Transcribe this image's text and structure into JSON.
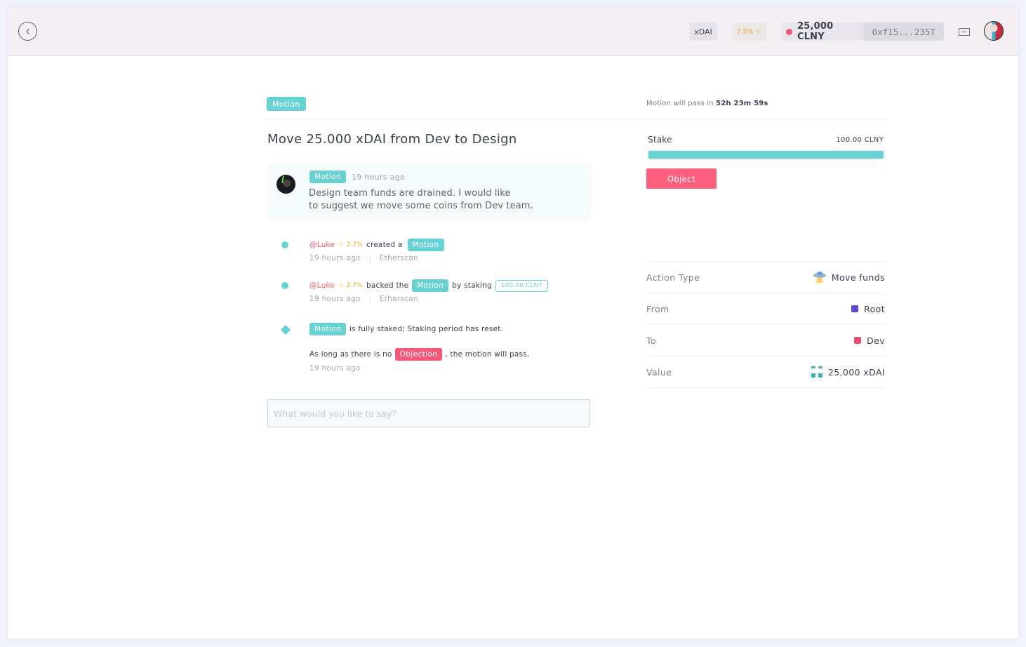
{
  "header": {
    "network": "xDAI",
    "reputation": "7.5%",
    "wallet_balance": "25,000 CLNY",
    "wallet_address": "0xf15...235T"
  },
  "motion": {
    "badge": "Motion",
    "timer_prefix": "Motion will pass in",
    "timer_value": "52h 23m 59s",
    "title": "Move 25.000 xDAI from Dev to Design"
  },
  "comment": {
    "badge": "Motion",
    "time": "19 hours ago",
    "text_line1": "Design team funds are drained. I would like",
    "text_line2": "to suggest we move some coins from Dev team."
  },
  "events": [
    {
      "user": "@Luke",
      "reputation": "2.7%",
      "action": "created a",
      "badge": "Motion",
      "time": "19 hours ago",
      "link": "Etherscan"
    },
    {
      "user": "@Luke",
      "reputation": "2.7%",
      "action": "backed the",
      "badge": "Motion",
      "action2": "by staking",
      "amount": "100.00 CLNY",
      "time": "19 hours ago",
      "link": "Etherscan"
    },
    {
      "badge": "Motion",
      "text": "is fully staked; Staking period has reset.",
      "text2_pre": "As long as there is no",
      "badge2": "Objection",
      "text2_post": ", the motion will pass.",
      "time": "19 hours ago"
    }
  ],
  "comment_input": {
    "placeholder": "What would you like to say?",
    "value": ""
  },
  "stake": {
    "label": "Stake",
    "amount": "100.00 CLNY",
    "progress_percent": 100,
    "object_button": "Object"
  },
  "details": [
    {
      "label": "Action Type",
      "value": "Move funds",
      "icon": "ufo-icon"
    },
    {
      "label": "From",
      "value": "Root",
      "color": "#5a48d8"
    },
    {
      "label": "To",
      "value": "Dev",
      "color": "#e4506c"
    },
    {
      "label": "Value",
      "value": "25,000 xDAI",
      "icon": "token-icon"
    }
  ],
  "colors": {
    "accent": "#68d2d2",
    "danger": "#fd5f7c",
    "user_link": "#f1576f",
    "reputation": "#f5a623"
  }
}
